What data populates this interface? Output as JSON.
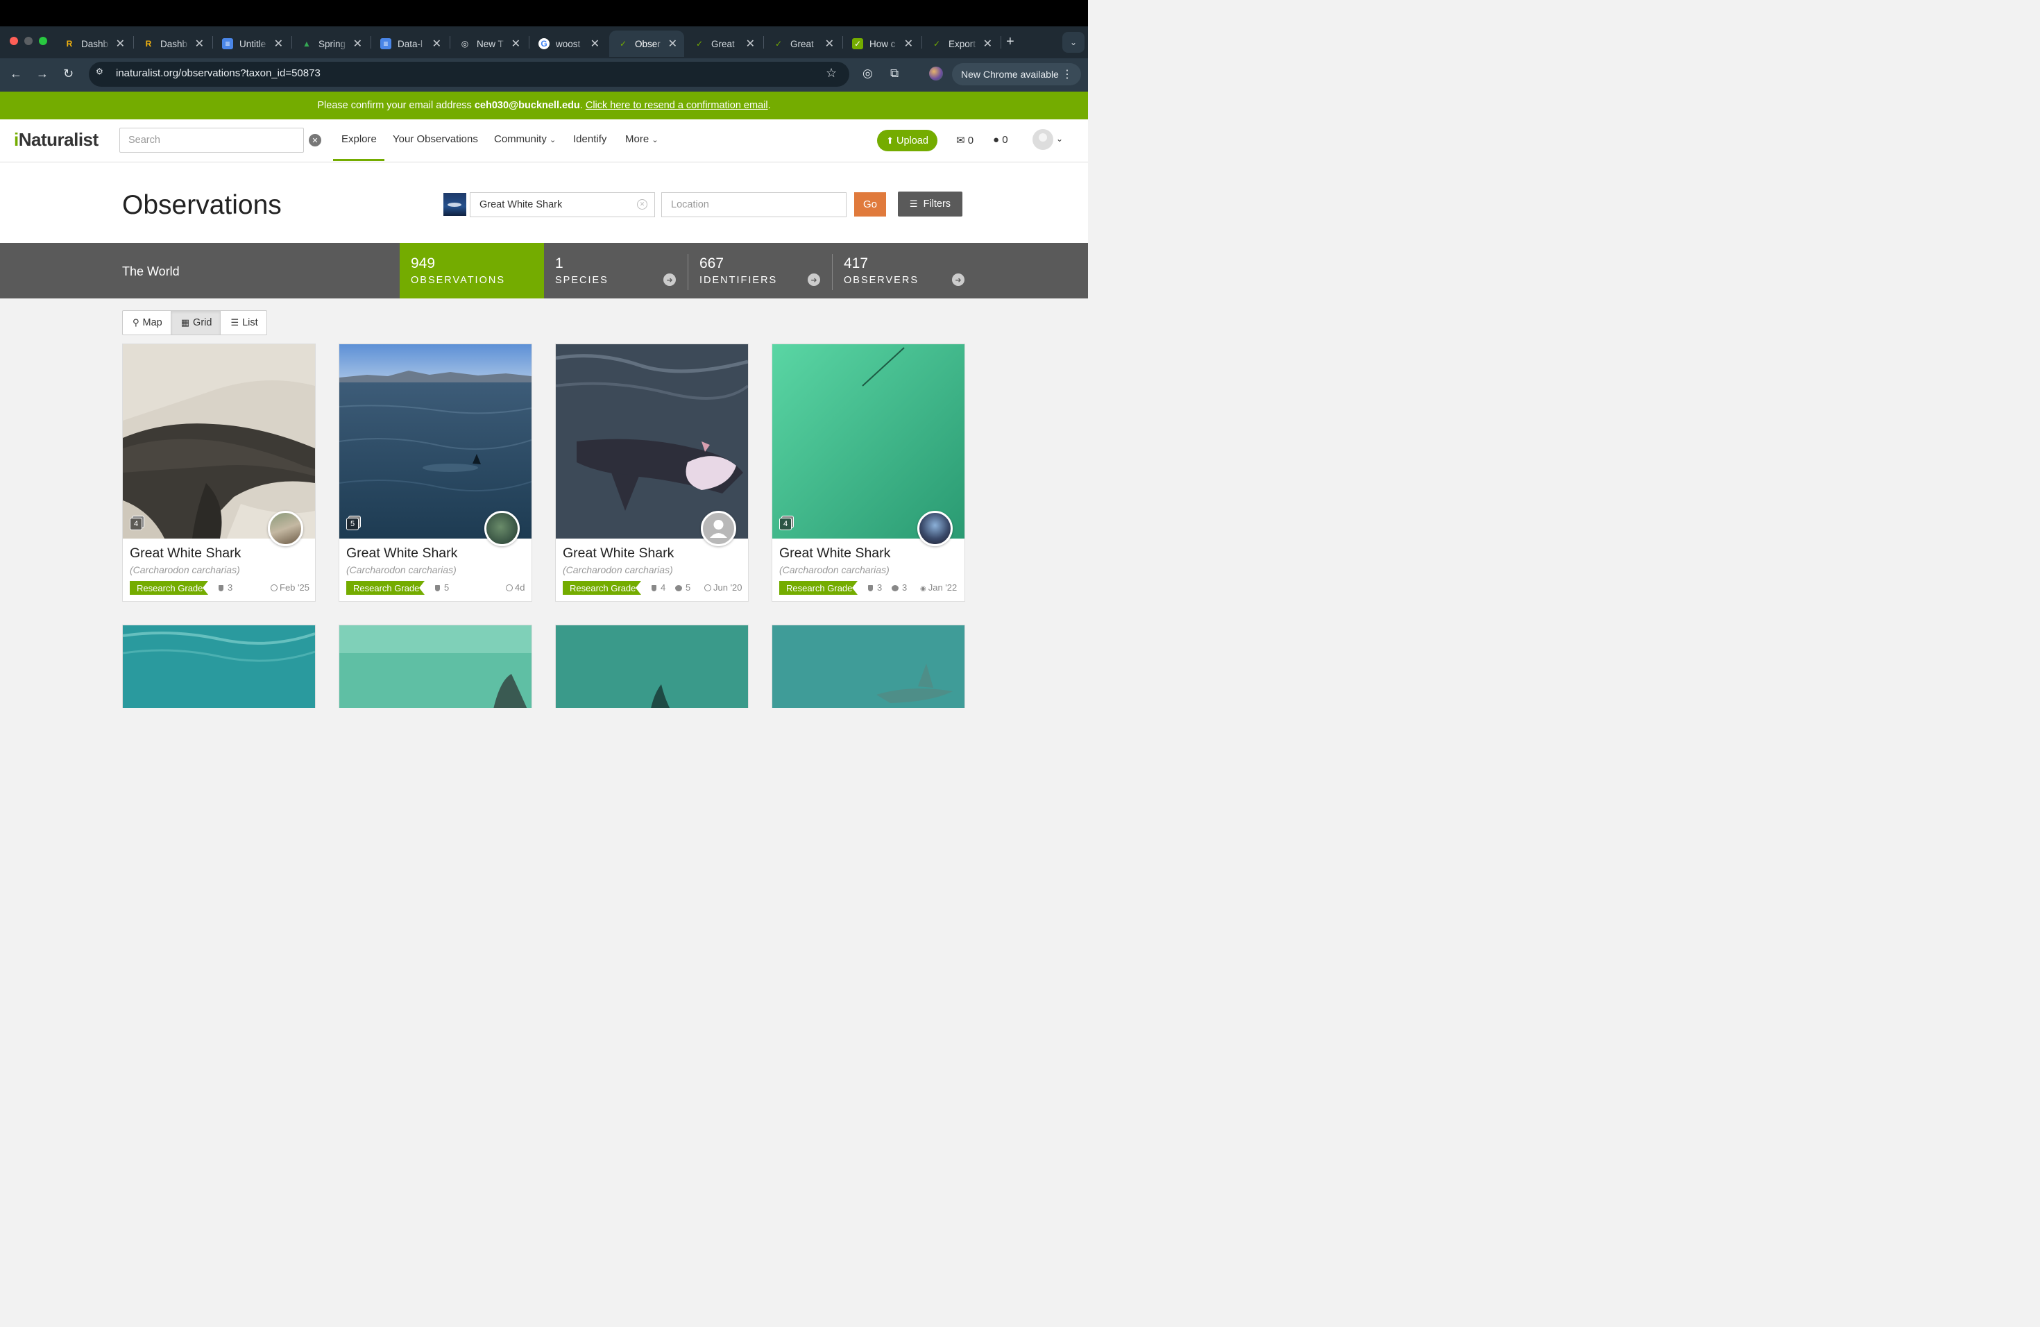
{
  "browser": {
    "tabs": [
      {
        "label": "Dashb",
        "fav": "R",
        "favcolor": "#f1b20f"
      },
      {
        "label": "Dashb",
        "fav": "R",
        "favcolor": "#f1b20f"
      },
      {
        "label": "Untitle",
        "fav": "≡",
        "favcolor": "#4a86e8"
      },
      {
        "label": "Spring",
        "fav": "▲",
        "favcolor": "#34a853"
      },
      {
        "label": "Data-l",
        "fav": "≡",
        "favcolor": "#4a86e8"
      },
      {
        "label": "New T",
        "fav": "◎",
        "favcolor": "#dfe3e6"
      },
      {
        "label": "woost",
        "fav": "G",
        "favcolor": "#ffffff"
      },
      {
        "label": "Obser",
        "fav": "✓",
        "favcolor": "#74ac00"
      },
      {
        "label": "Great",
        "fav": "✓",
        "favcolor": "#74ac00"
      },
      {
        "label": "Great",
        "fav": "✓",
        "favcolor": "#74ac00"
      },
      {
        "label": "How c",
        "fav": "✓",
        "favcolor": "#74ac00"
      },
      {
        "label": "Export",
        "fav": "✓",
        "favcolor": "#74ac00"
      }
    ],
    "url": "inaturalist.org/observations?taxon_id=50873",
    "update_label": "New Chrome available"
  },
  "banner": {
    "prefix": "Please confirm your email address ",
    "email": "ceh030@bucknell.edu",
    "mid": ". ",
    "link": "Click here to resend a confirmation email",
    "suffix": "."
  },
  "header": {
    "logo_i": "i",
    "logo_rest": "Naturalist",
    "search_placeholder": "Search",
    "nav": [
      "Explore",
      "Your Observations",
      "Community",
      "Identify",
      "More"
    ],
    "upload": "Upload",
    "messages_count": "0",
    "notifications_count": "0"
  },
  "page": {
    "title": "Observations",
    "taxon_value": "Great White Shark",
    "location_placeholder": "Location",
    "go": "Go",
    "filters": "Filters"
  },
  "stats": {
    "place": "The World",
    "observations": {
      "num": "949",
      "label": "OBSERVATIONS"
    },
    "species": {
      "num": "1",
      "label": "SPECIES"
    },
    "identifiers": {
      "num": "667",
      "label": "IDENTIFIERS"
    },
    "observers": {
      "num": "417",
      "label": "OBSERVERS"
    }
  },
  "views": [
    "Map",
    "Grid",
    "List"
  ],
  "cards": [
    {
      "name": "Great White Shark",
      "sci": "(Carcharodon carcharias)",
      "grade": "Research Grade",
      "photos": "4",
      "ids": "3",
      "comments": "",
      "date": "Feb '25"
    },
    {
      "name": "Great White Shark",
      "sci": "(Carcharodon carcharias)",
      "grade": "Research Grade",
      "photos": "5",
      "ids": "5",
      "comments": "",
      "date": "4d"
    },
    {
      "name": "Great White Shark",
      "sci": "(Carcharodon carcharias)",
      "grade": "Research Grade",
      "photos": "",
      "ids": "4",
      "comments": "5",
      "date": "Jun '20"
    },
    {
      "name": "Great White Shark",
      "sci": "(Carcharodon carcharias)",
      "grade": "Research Grade",
      "photos": "4",
      "ids": "3",
      "comments": "3",
      "date": "Jan '22"
    }
  ],
  "colors": {
    "brand": "#74ac00",
    "go": "#e07a3c",
    "stats_bg": "#5a5a5a"
  }
}
